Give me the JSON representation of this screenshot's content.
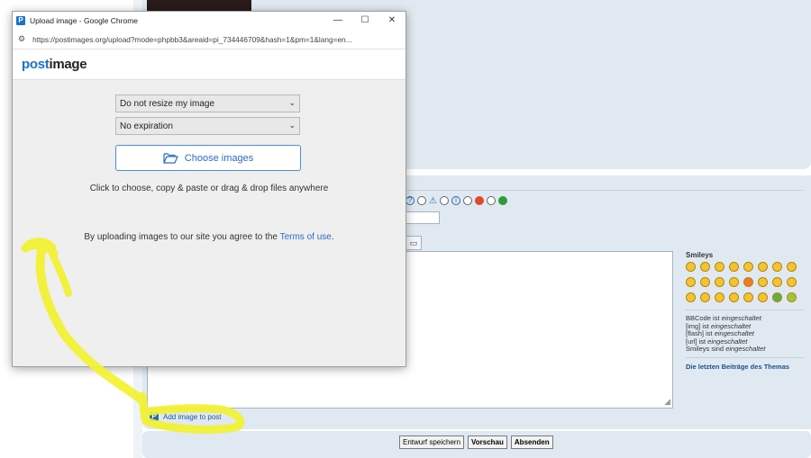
{
  "popup": {
    "window_title": "Upload image - Google Chrome",
    "favicon_letter": "P",
    "url": "https://postimages.org/upload?mode=phpbb3&areaid=pi_734446709&hash=1&pm=1&lang=en...",
    "logo_part1": "post",
    "logo_part2": "image",
    "resize_select": "Do not resize my image",
    "expiration_select": "No expiration",
    "choose_button": "Choose images",
    "hint": "Click to choose, copy & paste or drag & drop files anywhere",
    "terms_prefix": "By uploading images to our site you agree to the ",
    "terms_link": "Terms of use",
    "terms_suffix": "."
  },
  "forum": {
    "add_image_link": "Add image to post",
    "smileys_title": "Smileys",
    "bbcode_info": [
      {
        "label": "BBCode ist ",
        "state": "eingeschaltet"
      },
      {
        "label": "[img] ist ",
        "state": "eingeschaltet"
      },
      {
        "label": "[flash] ist ",
        "state": "eingeschaltet"
      },
      {
        "label": "[url] ist ",
        "state": "eingeschaltet"
      },
      {
        "label": "Smileys sind ",
        "state": "eingeschaltet"
      }
    ],
    "latest_posts_link": "Die letzten Beiträge des Themas",
    "buttons": {
      "draft": "Entwurf speichern",
      "preview": "Vorschau",
      "submit": "Absenden"
    }
  },
  "colors": {
    "accent_blue": "#1a73c9",
    "highlight_yellow": "#f2f230",
    "forum_panel": "#e0e9f1"
  }
}
